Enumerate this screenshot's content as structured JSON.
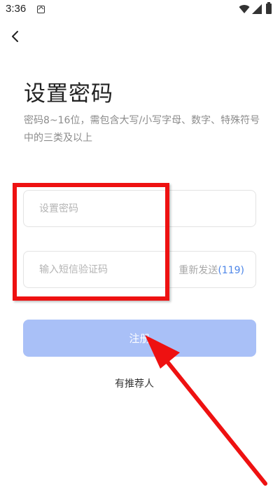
{
  "status_bar": {
    "time": "3:36",
    "icons": [
      "app-notification-icon",
      "wifi-icon",
      "signal-icon",
      "battery-icon"
    ]
  },
  "nav": {
    "back_icon": "chevron-left-icon"
  },
  "page": {
    "title": "设置密码",
    "description": "密码8~16位，需包含大写/小写字母、数字、特殊符号中的三类及以上"
  },
  "form": {
    "password_placeholder": "设置密码",
    "code_placeholder": "输入短信验证码",
    "resend_label": "重新发送",
    "resend_countdown": "(119)",
    "register_label": "注册",
    "referrer_label": "有推荐人"
  },
  "colors": {
    "primary_disabled": "#a9c0f7",
    "countdown": "#4d86e8",
    "annotation_red": "#ee1111"
  }
}
